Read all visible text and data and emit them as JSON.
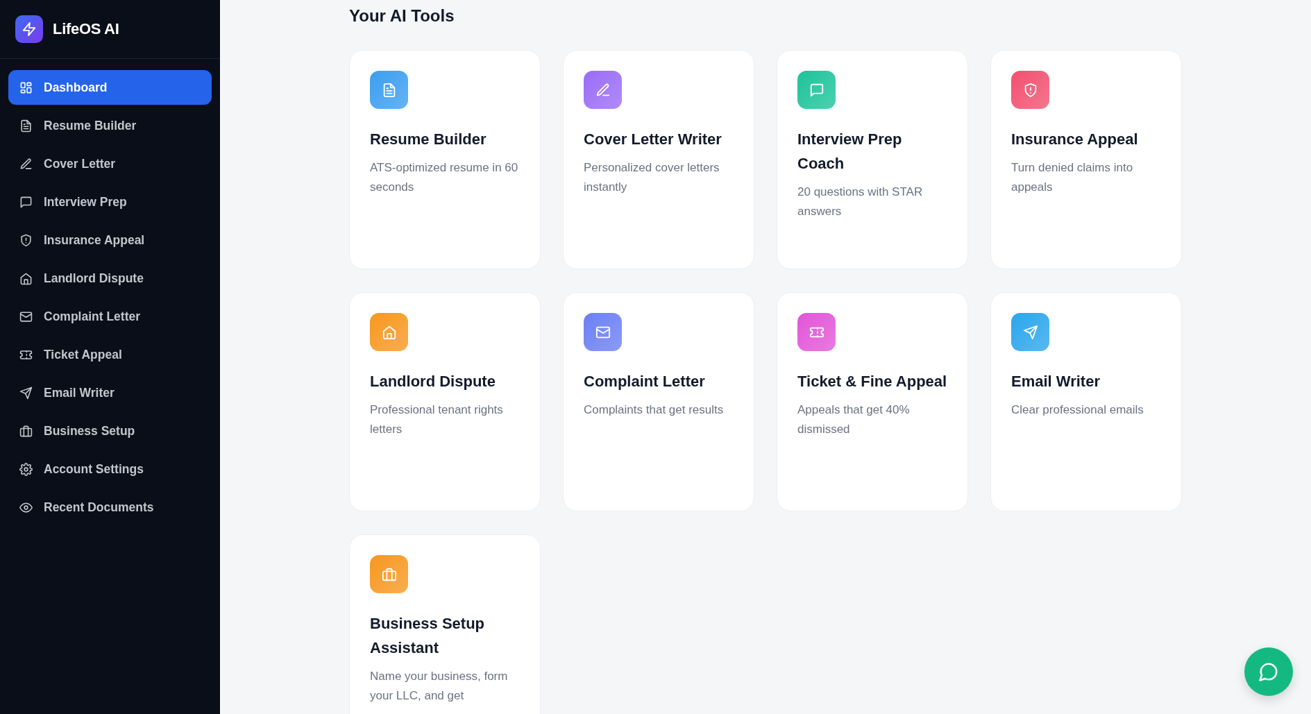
{
  "sidebar": {
    "brand": "LifeOS AI",
    "items": [
      {
        "label": "Dashboard",
        "selected": true
      },
      {
        "label": "Resume Builder",
        "selected": false
      },
      {
        "label": "Cover Letter",
        "selected": false
      },
      {
        "label": "Interview Prep",
        "selected": false
      },
      {
        "label": "Insurance Appeal",
        "selected": false
      },
      {
        "label": "Landlord Dispute",
        "selected": false
      },
      {
        "label": "Complaint Letter",
        "selected": false
      },
      {
        "label": "Ticket Appeal",
        "selected": false
      },
      {
        "label": "Email Writer",
        "selected": false
      },
      {
        "label": "Business Setup",
        "selected": false
      },
      {
        "label": "Account Settings",
        "selected": false
      },
      {
        "label": "Recent Documents",
        "selected": false
      }
    ]
  },
  "main": {
    "heading": "Your AI Tools",
    "tools": [
      {
        "title": "Resume Builder",
        "description": "ATS-optimized resume in 60 seconds",
        "color": "#3b9ef0"
      },
      {
        "title": "Cover Letter Writer",
        "description": "Personalized cover letters instantly",
        "color": "#9a6cf6"
      },
      {
        "title": "Interview Prep Coach",
        "description": "20 questions with STAR answers",
        "color": "#1cc39a"
      },
      {
        "title": "Insurance Appeal",
        "description": "Turn denied claims into appeals",
        "color": "#f2506f"
      },
      {
        "title": "Landlord Dispute",
        "description": "Professional tenant rights letters",
        "color": "#f7971f"
      },
      {
        "title": "Complaint Letter",
        "description": "Complaints that get results",
        "color": "#6b7ff3"
      },
      {
        "title": "Ticket & Fine Appeal",
        "description": "Appeals that get 40% dismissed",
        "color": "#e255d8"
      },
      {
        "title": "Email Writer",
        "description": "Clear professional emails",
        "color": "#2aa6ec"
      },
      {
        "title": "Business Setup Assistant",
        "description": "Name your business, form your LLC, and get",
        "color": "#f7971f"
      }
    ]
  }
}
